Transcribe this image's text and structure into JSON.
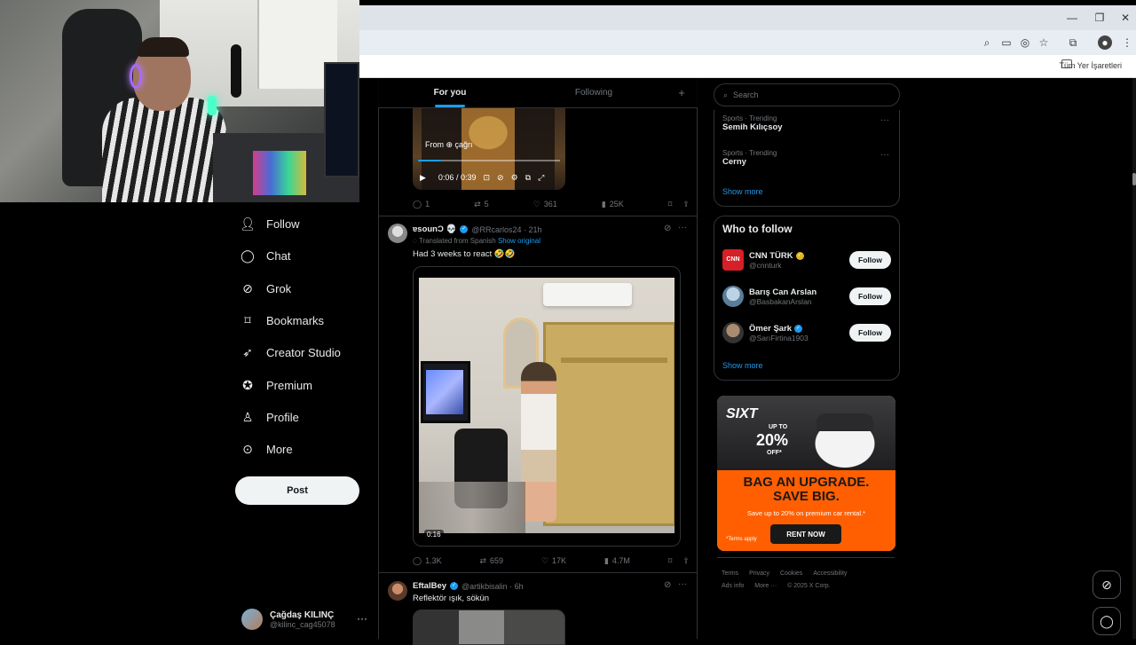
{
  "browser": {
    "window_controls": {
      "minimize": "—",
      "restore": "❐",
      "close": "✕"
    },
    "toolbar_icons": [
      "zoom-icon",
      "cast-icon",
      "eye-off-icon",
      "star-icon",
      "extensions-icon",
      "profile-icon",
      "kebab-icon"
    ],
    "bookmarks_label": "Tüm Yer İşaretleri"
  },
  "nav": {
    "items": [
      {
        "label": "Follow",
        "icon": "person-plus-icon"
      },
      {
        "label": "Chat",
        "icon": "chat-icon"
      },
      {
        "label": "Grok",
        "icon": "grok-icon"
      },
      {
        "label": "Bookmarks",
        "icon": "bookmark-icon"
      },
      {
        "label": "Creator Studio",
        "icon": "rocket-icon"
      },
      {
        "label": "Premium",
        "icon": "verified-badge-icon"
      },
      {
        "label": "Profile",
        "icon": "person-icon"
      },
      {
        "label": "More",
        "icon": "more-circle-icon"
      }
    ],
    "post_label": "Post",
    "account": {
      "name": "Çağdaş KILINÇ",
      "handle": "@kilinc_cag45078"
    }
  },
  "feed": {
    "tabs": [
      "For you",
      "Following"
    ],
    "video1": {
      "from": "From ⊕ çağrı",
      "time": "0:06 / 0:39"
    },
    "tweet1_stats": {
      "replies": "1",
      "reposts": "5",
      "likes": "361",
      "views": "25K"
    },
    "tweet2": {
      "name": "ɐsoun",
      "name_suffix": "Ͻ 💀",
      "handle": "@RRcarlos24 · 21h",
      "translated": "Translated from Spanish",
      "show_original": "Show original",
      "text": "Had 3 weeks to react 🤣🤣",
      "duration": "0:16",
      "stats": {
        "replies": "1.3K",
        "reposts": "659",
        "likes": "17K",
        "views": "4.7M"
      }
    },
    "tweet3": {
      "name": "EftalBey",
      "handle": "@artikbisalin · 6h",
      "text": "Reflektör ışık, sökün"
    }
  },
  "sidebar": {
    "search_placeholder": "Search",
    "trends": [
      {
        "category": "Sports · Trending",
        "name": "Semih Kılıçsoy"
      },
      {
        "category": "Sports · Trending",
        "name": "Cerny"
      }
    ],
    "show_more": "Show more",
    "who_to_follow": {
      "title": "Who to follow",
      "accounts": [
        {
          "name": "CNN TÜRK",
          "handle": "@cnnturk",
          "badge": "gold"
        },
        {
          "name": "Barış Can Arslan",
          "handle": "@BasbakanArslan",
          "badge": "none"
        },
        {
          "name": "Ömer Şark",
          "handle": "@SarıFirtina1903",
          "badge": "blue"
        }
      ],
      "follow_label": "Follow",
      "show_more": "Show more"
    },
    "ad": {
      "brand": "SIXT",
      "up_to": "UP TO",
      "percent": "20%",
      "off": "OFF*",
      "headline_1": "BAG AN UPGRADE.",
      "headline_2": "SAVE BIG.",
      "subtext": "Save up to 20% on premium car rental.*",
      "terms": "*Terms apply",
      "cta": "RENT NOW"
    },
    "footer": {
      "row1": [
        "Terms",
        "Privacy",
        "Cookies",
        "Accessibility"
      ],
      "row2": [
        "Ads info",
        "More ···",
        "© 2025 X Corp."
      ]
    }
  },
  "colors": {
    "accent": "#1d9bf0",
    "background": "#000000",
    "ad_orange": "#ff5f00"
  }
}
